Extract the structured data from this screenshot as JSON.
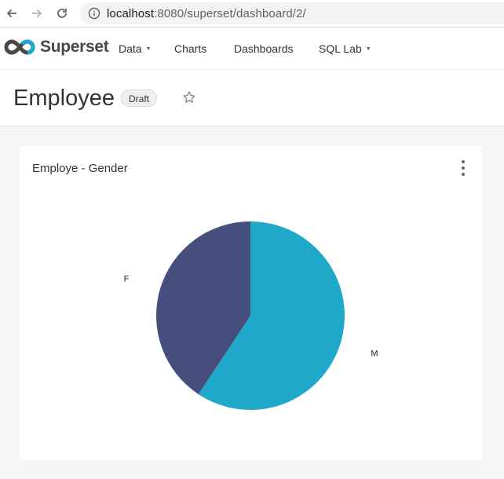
{
  "browser": {
    "url_host": "localhost",
    "url_rest": ":8080/superset/dashboard/2/"
  },
  "nav": {
    "brand": "Superset",
    "items": [
      {
        "label": "Data",
        "dropdown": true
      },
      {
        "label": "Charts",
        "dropdown": false
      },
      {
        "label": "Dashboards",
        "dropdown": false
      },
      {
        "label": "SQL Lab",
        "dropdown": true
      }
    ]
  },
  "dashboard": {
    "title": "Employee",
    "status_badge": "Draft"
  },
  "chart": {
    "title": "Employe - Gender"
  },
  "chart_data": {
    "type": "pie",
    "title": "Employe - Gender",
    "slices": [
      {
        "label": "M",
        "value": 59.3,
        "color": "#1fa8c9"
      },
      {
        "label": "F",
        "value": 40.7,
        "color": "#454e7c"
      }
    ]
  },
  "colors": {
    "accent": "#1fa8c9",
    "secondary": "#454e7c"
  }
}
